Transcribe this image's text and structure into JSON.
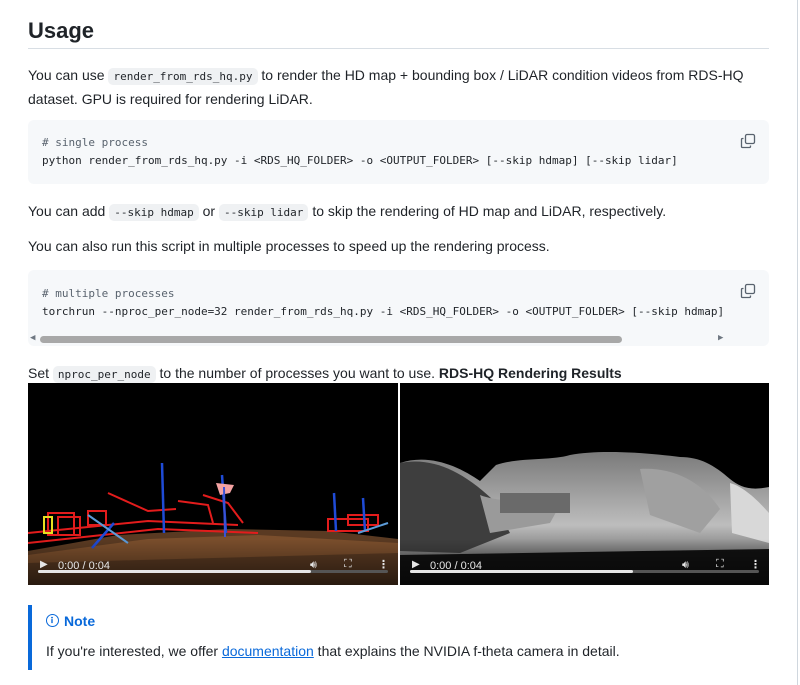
{
  "section": {
    "title": "Usage"
  },
  "intro": {
    "before": "You can use ",
    "code": "render_from_rds_hq.py",
    "after_line1": " to render the HD map + bounding box / LiDAR condition videos from RDS-HQ",
    "line2": "dataset. GPU is required for rendering LiDAR."
  },
  "code_single": {
    "comment": "# single process",
    "cmd_prefix": "python render_from_rds_hq.py -i ",
    "in_folder": "<RDS_HQ_FOLDER>",
    "mid": " -o ",
    "out_folder": "<OUTPUT_FOLDER>",
    "suffix": " [--skip hdmap] [--skip lidar]"
  },
  "skip_para": {
    "before": "You can add ",
    "code1": "--skip hdmap",
    "mid": " or ",
    "code2": "--skip lidar",
    "after": " to skip the rendering of HD map and LiDAR, respectively."
  },
  "multi_para": "You can also run this script in multiple processes to speed up the rendering process.",
  "code_multi": {
    "comment": "# multiple processes",
    "cmd_prefix": "torchrun --nproc_per_node=32 render_from_rds_hq.py -i ",
    "in_folder": "<RDS_HQ_FOLDER>",
    "mid": " -o ",
    "out_folder": "<OUTPUT_FOLDER>",
    "suffix": " [--skip hdmap]",
    "scroll_left": "◀",
    "scroll_right": "▶"
  },
  "set_para": {
    "before": "Set ",
    "code": "nproc_per_node",
    "after": " to the number of processes you want to use. ",
    "bold": "RDS-HQ Rendering Results"
  },
  "videos": [
    {
      "time": "0:00 / 0:04",
      "progress": 0.78
    },
    {
      "time": "0:00 / 0:04",
      "progress": 0.64
    }
  ],
  "icons": {
    "copy": "copy-icon",
    "play": "play-icon",
    "volume": "volume-icon",
    "fullscreen": "fullscreen-icon",
    "more": "more-vertical-icon",
    "info": "info-icon"
  },
  "note": {
    "label": "Note",
    "before": "If you're interested, we offer ",
    "link": "documentation",
    "after": " that explains the NVIDIA f-theta camera in detail."
  },
  "colors": {
    "accent": "#0969da",
    "code_bg": "#f6f8fa",
    "text": "#1f2328"
  }
}
